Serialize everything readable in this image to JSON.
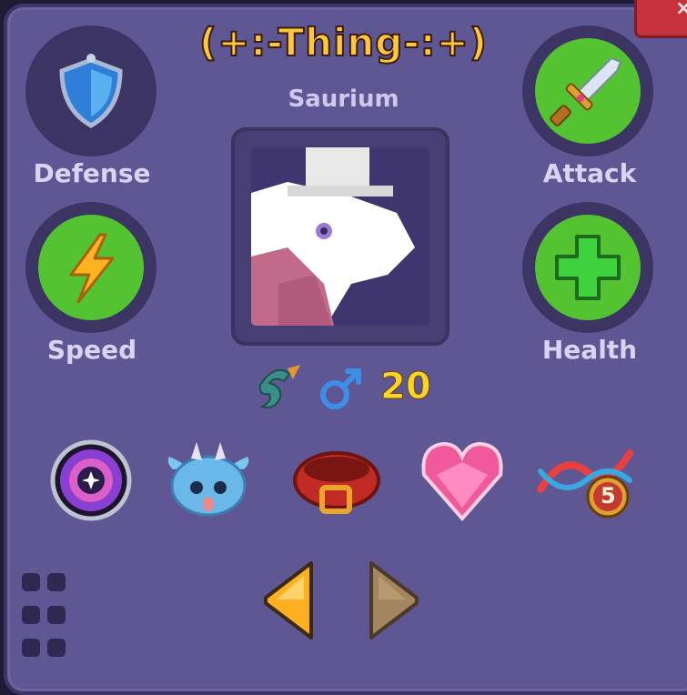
{
  "pet": {
    "name": "(+:-Thing-:+)",
    "species": "Saurium",
    "level": "20",
    "gender_icon": "male-symbol-icon"
  },
  "stats": {
    "defense": "Defense",
    "attack": "Attack",
    "speed": "Speed",
    "health": "Health"
  },
  "close": {
    "label": "×"
  },
  "items": [
    "vortex-orb-icon",
    "blue-dragon-hat-icon",
    "red-collar-icon",
    "pink-heart-gem-icon",
    "dna-5-icon"
  ],
  "dna_badge": "5",
  "colors": {
    "panel": "#5f5694",
    "accent_green": "#54c332",
    "title": "#ffc83a",
    "level": "#ffd22a"
  }
}
